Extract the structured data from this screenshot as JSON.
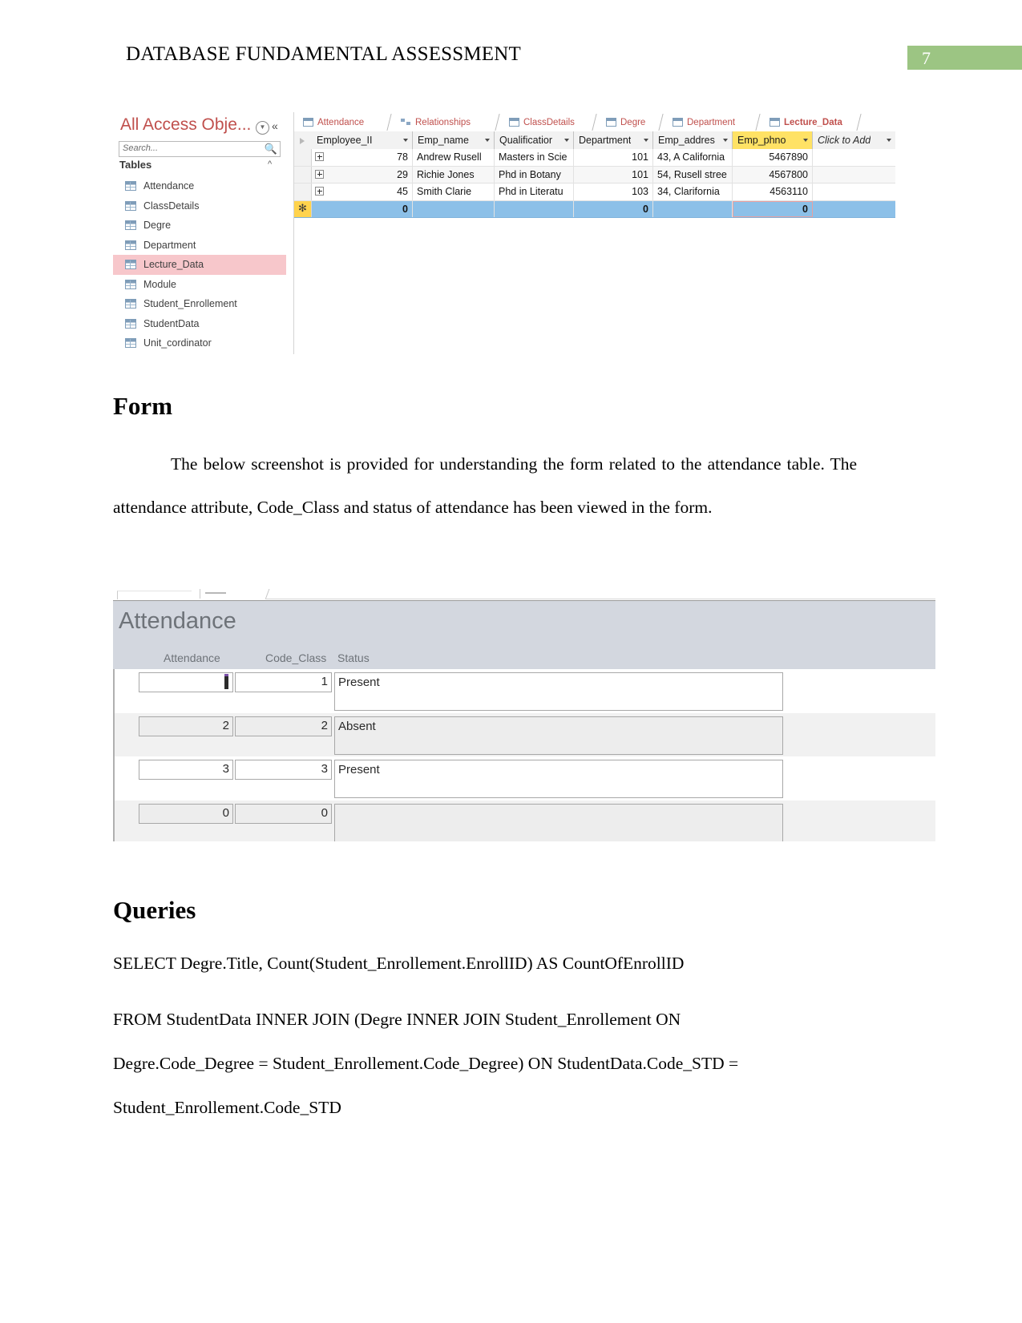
{
  "header": {
    "title": "DATABASE FUNDAMENTAL ASSESSMENT",
    "page_number": "7",
    "band_color": "#9CC583"
  },
  "access_screenshot": {
    "nav_pane": {
      "title": "All Access Obje...",
      "dropdown_icon": "chevron-down-circle-icon",
      "collapse_icon": "double-chevron-left-icon",
      "search_placeholder": "Search...",
      "search_icon": "magnifier-icon",
      "group_label": "Tables",
      "group_chevron": "chevron-up-icon",
      "selected_item": "Lecture_Data",
      "items": [
        {
          "label": "Attendance",
          "selected": false
        },
        {
          "label": "ClassDetails",
          "selected": false
        },
        {
          "label": "Degre",
          "selected": false
        },
        {
          "label": "Department",
          "selected": false
        },
        {
          "label": "Lecture_Data",
          "selected": true
        },
        {
          "label": "Module",
          "selected": false
        },
        {
          "label": "Student_Enrollement",
          "selected": false
        },
        {
          "label": "StudentData",
          "selected": false
        },
        {
          "label": "Unit_cordinator",
          "selected": false
        }
      ]
    },
    "tabs": [
      {
        "label": "Attendance",
        "icon": "table-icon",
        "active": false
      },
      {
        "label": "Relationships",
        "icon": "relationships-icon",
        "active": false
      },
      {
        "label": "ClassDetails",
        "icon": "table-icon",
        "active": false
      },
      {
        "label": "Degre",
        "icon": "table-icon",
        "active": false
      },
      {
        "label": "Department",
        "icon": "table-icon",
        "active": false
      },
      {
        "label": "Lecture_Data",
        "icon": "table-icon",
        "active": true
      }
    ],
    "datasheet": {
      "columns": [
        {
          "label": "Employee_II",
          "highlight": false
        },
        {
          "label": "Emp_name",
          "highlight": false
        },
        {
          "label": "Qualificatior",
          "highlight": false
        },
        {
          "label": "Department",
          "highlight": false
        },
        {
          "label": "Emp_addres",
          "highlight": false
        },
        {
          "label": "Emp_phno",
          "highlight": true
        }
      ],
      "add_column_label": "Click to Add",
      "rows": [
        {
          "employee_id": "78",
          "emp_name": "Andrew Rusell",
          "qualification": "Masters in Scie",
          "department": "101",
          "emp_address": "43, A California",
          "emp_phno": "5467890"
        },
        {
          "employee_id": "29",
          "emp_name": "Richie Jones",
          "qualification": "Phd in Botany",
          "department": "101",
          "emp_address": "54, Rusell stree",
          "emp_phno": "4567800"
        },
        {
          "employee_id": "45",
          "emp_name": "Smith Clarie",
          "qualification": "Phd in Literatu",
          "department": "103",
          "emp_address": "34, Clarifornia",
          "emp_phno": "4563110"
        }
      ],
      "new_row": {
        "employee_id": "0",
        "emp_name": "",
        "qualification": "",
        "department": "0",
        "emp_address": "",
        "emp_phno": "0"
      },
      "new_row_marker": "✻",
      "expand_icon": "plus-box-icon"
    }
  },
  "form_section": {
    "heading": "Form",
    "paragraph": "The below screenshot is provided for understanding the form related to the attendance table. The attendance attribute, Code_Class and status of attendance has been viewed in the form."
  },
  "form_screenshot": {
    "title": "Attendance",
    "column_labels": [
      "Attendance",
      "Code_Class",
      "Status"
    ],
    "rows": [
      {
        "attendance": "",
        "code_class": "1",
        "status": "Present",
        "has_caret": true
      },
      {
        "attendance": "2",
        "code_class": "2",
        "status": "Absent",
        "has_caret": false
      },
      {
        "attendance": "3",
        "code_class": "3",
        "status": "Present",
        "has_caret": false
      },
      {
        "attendance": "0",
        "code_class": "0",
        "status": "",
        "has_caret": false
      }
    ]
  },
  "queries_section": {
    "heading": "Queries",
    "sql_lines": [
      "SELECT Degre.Title, Count(Student_Enrollement.EnrollID) AS CountOfEnrollID",
      "FROM StudentData INNER JOIN (Degre INNER JOIN Student_Enrollement ON",
      "Degre.Code_Degree = Student_Enrollement.Code_Degree) ON StudentData.Code_STD =",
      "Student_Enrollement.Code_STD"
    ]
  }
}
